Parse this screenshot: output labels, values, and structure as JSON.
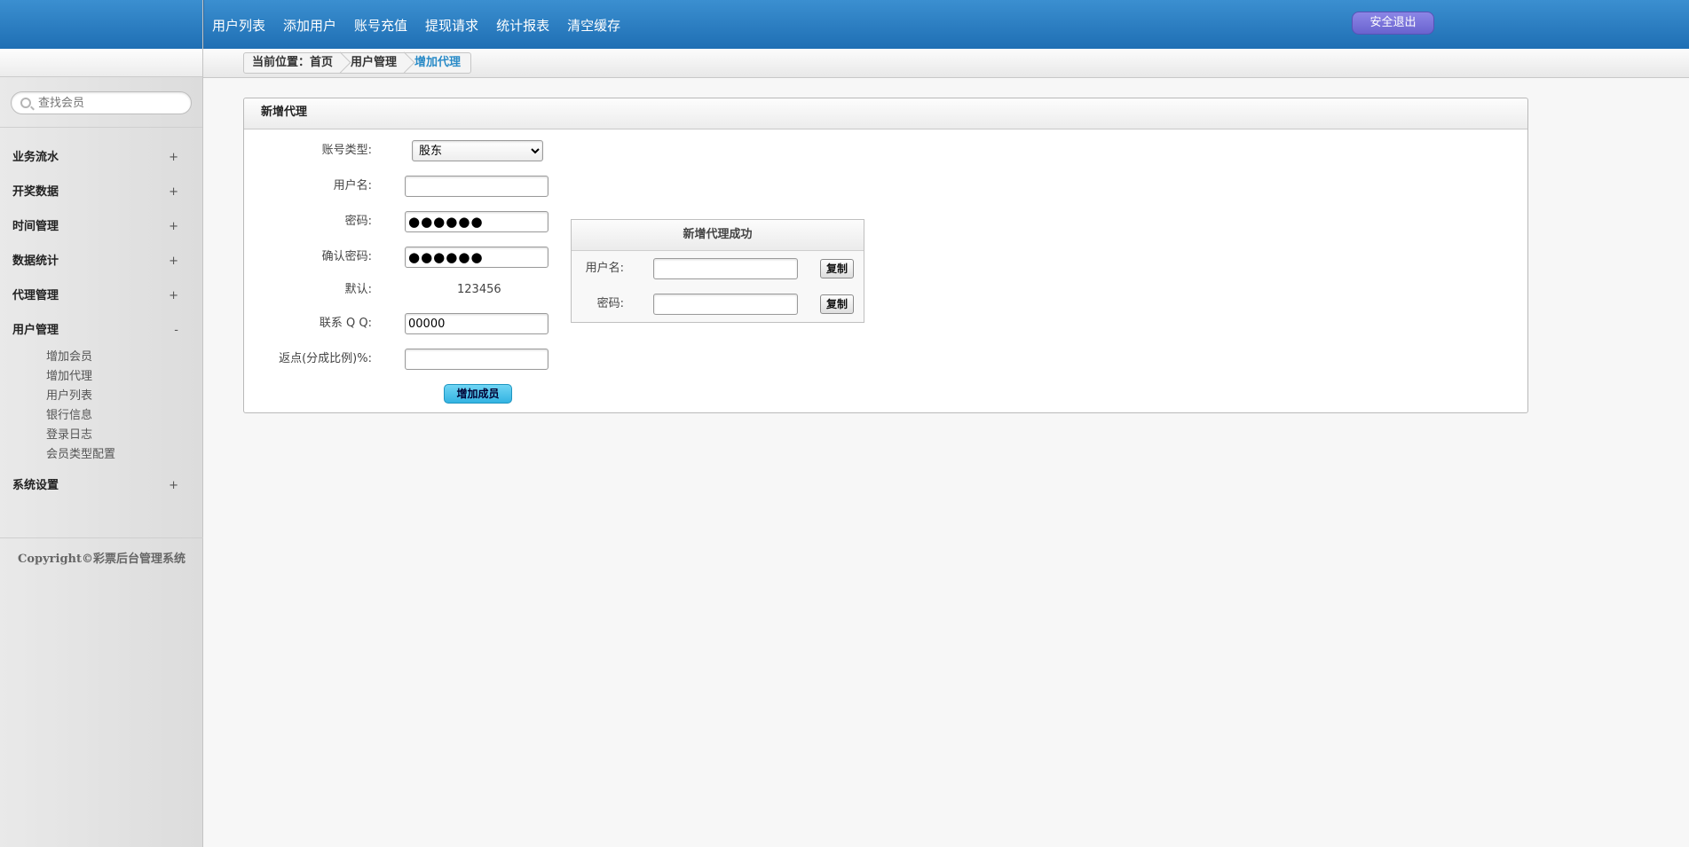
{
  "topnav": {
    "links": [
      "用户列表",
      "添加用户",
      "账号充值",
      "提现请求",
      "统计报表",
      "清空缓存"
    ],
    "logout_label": "安全退出"
  },
  "breadcrumb": [
    "当前位置：首页",
    "用户管理",
    "增加代理"
  ],
  "sidebar": {
    "search_placeholder": "查找会员",
    "menus": [
      {
        "label": "业务流水",
        "toggle": "+"
      },
      {
        "label": "开奖数据",
        "toggle": "+"
      },
      {
        "label": "时间管理",
        "toggle": "+"
      },
      {
        "label": "数据统计",
        "toggle": "+"
      },
      {
        "label": "代理管理",
        "toggle": "+"
      },
      {
        "label": "用户管理",
        "toggle": "-"
      },
      {
        "label": "系统设置",
        "toggle": "+"
      }
    ],
    "user_mgmt_items": [
      "增加会员",
      "增加代理",
      "用户列表",
      "银行信息",
      "登录日志",
      "会员类型配置"
    ],
    "copyright": "Copyright©彩票后台管理系统"
  },
  "panel": {
    "title": "新增代理",
    "account_type_label": "账号类型:",
    "account_type_value": "股东",
    "username_label": "用户名:",
    "username_value": "",
    "password_label": "密码:",
    "password_value": "●●●●●●",
    "confirm_label": "确认密码:",
    "confirm_value": "●●●●●●",
    "default_label": "默认:",
    "default_value": "123456",
    "qq_label": "联系 Q Q:",
    "qq_value": "00000",
    "rebate_label": "返点(分成比例)%:",
    "rebate_value": "",
    "submit_label": "增加成员"
  },
  "success": {
    "title": "新增代理成功",
    "username_label": "用户名:",
    "username_value": "",
    "password_label": "密码:",
    "password_value": "",
    "copy_label": "复制"
  }
}
